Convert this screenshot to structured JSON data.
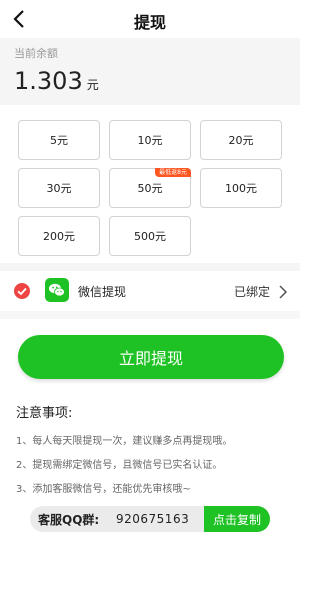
{
  "header": {
    "title": "提现"
  },
  "balance": {
    "label": "当前余额",
    "value": "1.303",
    "unit": "元"
  },
  "amounts": [
    {
      "label": "5元"
    },
    {
      "label": "10元"
    },
    {
      "label": "20元"
    },
    {
      "label": "30元"
    },
    {
      "label": "50元",
      "tag": "最低返8元"
    },
    {
      "label": "100元"
    },
    {
      "label": "200元"
    },
    {
      "label": "500元"
    }
  ],
  "payment": {
    "method_label": "微信提现",
    "status_label": "已绑定",
    "selected": true
  },
  "withdraw_button": {
    "label": "立即提现"
  },
  "notes": {
    "title": "注意事项:",
    "items": [
      "1、每人每天限提现一次，建议赚多点再提现哦。",
      "2、提现需绑定微信号，且微信号已实名认证。",
      "3、添加客服微信号，还能优先审核哦~"
    ]
  },
  "qq_group": {
    "label": "客服QQ群:",
    "number": "920675163",
    "copy_label": "点击复制"
  },
  "colors": {
    "accent_green": "#1fc224",
    "tag_orange": "#ff5722",
    "check_red": "#ee4444"
  },
  "icons": {
    "back": "back-arrow-icon",
    "check": "check-circle-icon",
    "wechat": "wechat-icon",
    "chevron": "chevron-right-icon"
  }
}
